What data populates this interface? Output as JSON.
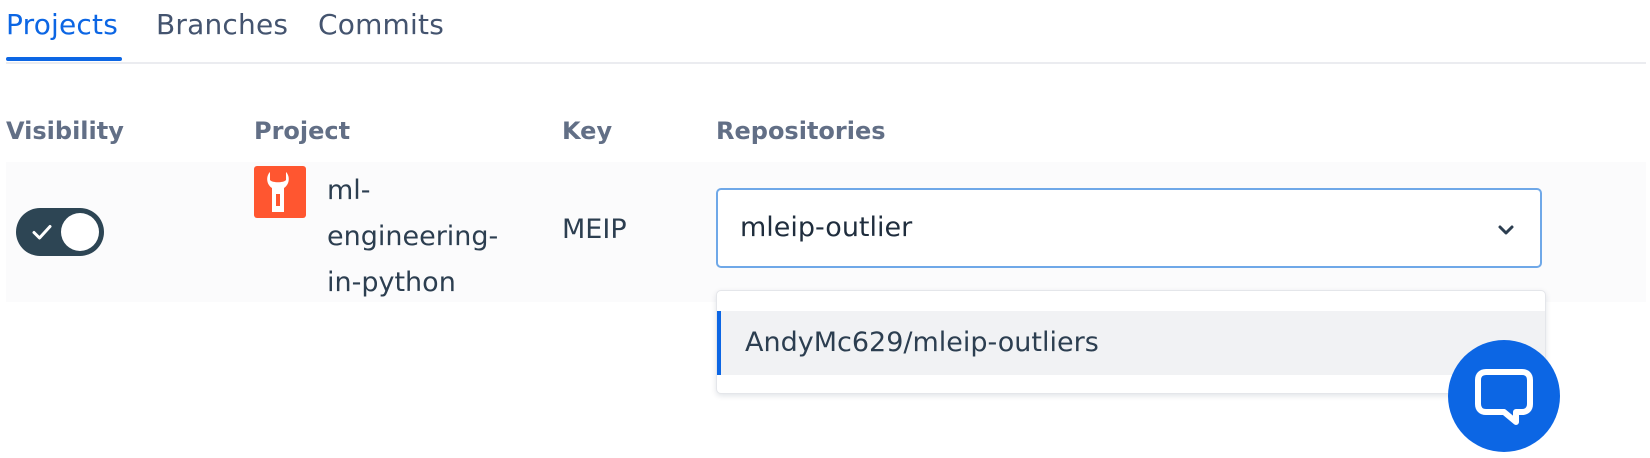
{
  "tabs": [
    {
      "label": "Projects",
      "active": true
    },
    {
      "label": "Branches",
      "active": false
    },
    {
      "label": "Commits",
      "active": false
    }
  ],
  "table": {
    "headers": {
      "visibility": "Visibility",
      "project": "Project",
      "key": "Key",
      "repositories": "Repositories"
    },
    "row": {
      "visibility_enabled": true,
      "project_name": "ml-engineering-in-python",
      "project_name_lines": [
        "ml-",
        "engineering-",
        "in-python"
      ],
      "key": "MEIP",
      "repository_selected": "mleip-outlier",
      "repository_options": [
        "AndyMc629/mleip-outliers"
      ]
    }
  },
  "icons": {
    "toggle": "check-icon",
    "avatar": "wrench-icon",
    "select": "chevron-down-icon",
    "chat": "chat-bubble-icon"
  },
  "colors": {
    "accent": "#0c66e4",
    "toggle_on": "#2d4554",
    "avatar_bg": "#ff5630",
    "select_border": "#6fa8e8"
  }
}
